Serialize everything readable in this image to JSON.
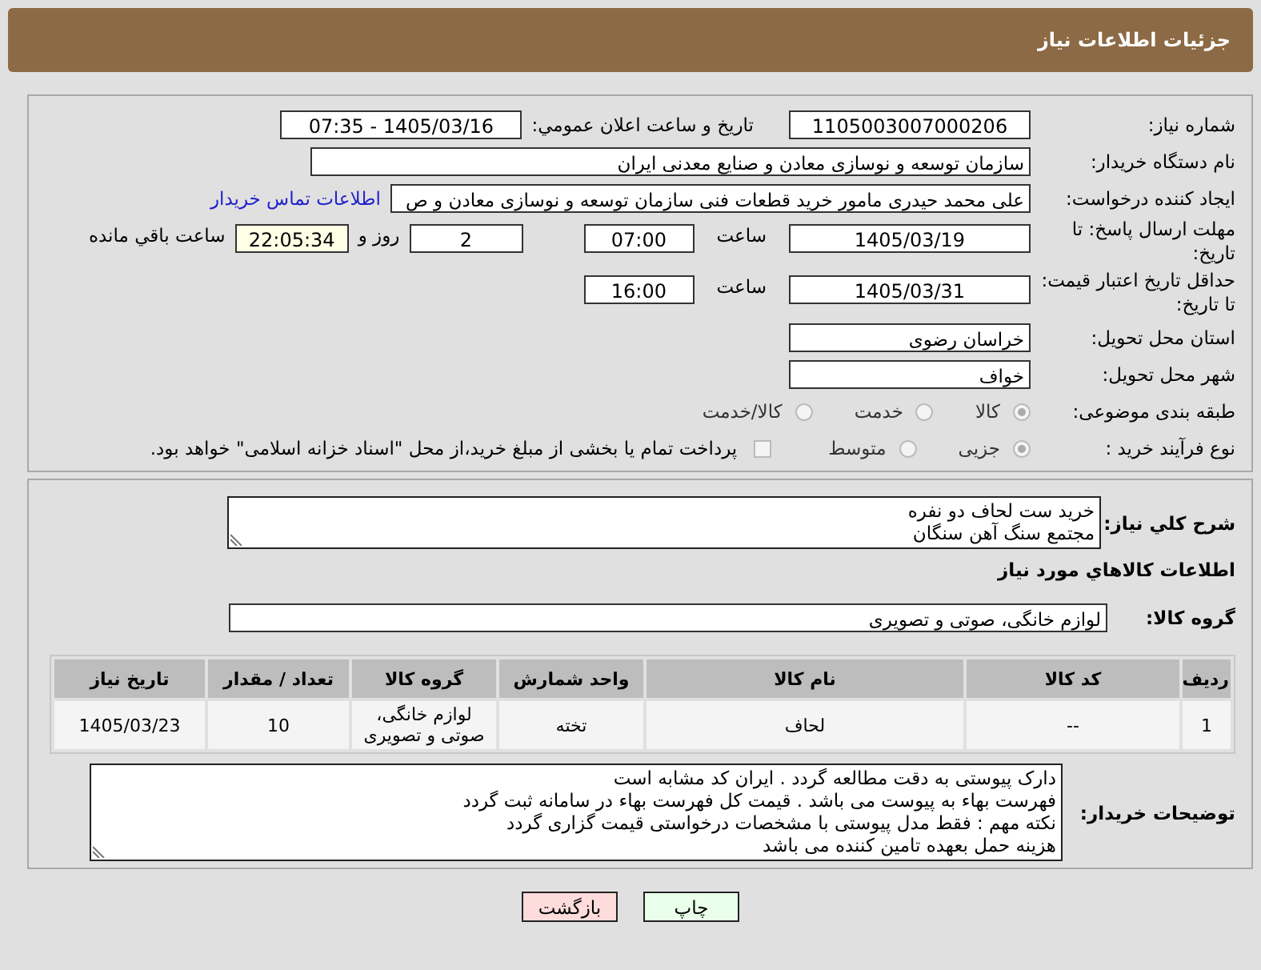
{
  "header": {
    "title": "جزئیات اطلاعات نیاز"
  },
  "need_number": {
    "label": "شماره نیاز:",
    "value": "1105003007000206"
  },
  "announce": {
    "label": "تاریخ و ساعت اعلان عمومي:",
    "value": "1405/03/16 - 07:35"
  },
  "buyer_org": {
    "label": "نام دستگاه خریدار:",
    "value": "سازمان توسعه و نوسازی معادن و صنایع معدنی ایران"
  },
  "requester": {
    "label": "ایجاد کننده درخواست:",
    "value": "علی محمد حیدری مامور خرید قطعات فنی سازمان توسعه و نوسازی معادن و ص",
    "link": "اطلاعات تماس خریدار"
  },
  "deadline": {
    "label": "مهلت ارسال پاسخ: تا تاریخ:",
    "date": "1405/03/19",
    "time_label": "ساعت",
    "time": "07:00",
    "days": "2",
    "days_label": "روز و",
    "remaining": "22:05:34",
    "remaining_label": "ساعت باقي مانده"
  },
  "validity": {
    "label": "حداقل تاریخ اعتبار قیمت: تا تاریخ:",
    "date": "1405/03/31",
    "time_label": "ساعت",
    "time": "16:00"
  },
  "province": {
    "label": "استان محل تحویل:",
    "value": "خراسان رضوی"
  },
  "city": {
    "label": "شهر محل تحویل:",
    "value": "خواف"
  },
  "category": {
    "label": "طبقه بندی موضوعی:",
    "options": [
      {
        "label": "کالا",
        "selected": true
      },
      {
        "label": "خدمت",
        "selected": false
      },
      {
        "label": "کالا/خدمت",
        "selected": false
      }
    ]
  },
  "process": {
    "label": "نوع فرآیند خرید :",
    "options": [
      {
        "label": "جزیی",
        "selected": true
      },
      {
        "label": "متوسط",
        "selected": false
      }
    ],
    "treasury": {
      "label": "پرداخت تمام یا بخشی از مبلغ خرید،از محل \"اسناد خزانه اسلامی\" خواهد بود.",
      "checked": false
    }
  },
  "description": {
    "label": "شرح کلي نیاز:",
    "lines": [
      "خرید ست لحاف دو نفره",
      "مجتمع سنگ آهن سنگان"
    ]
  },
  "goods_title": "اطلاعات کالاهاي مورد نیاز",
  "goods_group": {
    "label": "گروه کالا:",
    "value": "لوازم خانگی، صوتی و تصویری"
  },
  "table": {
    "columns": [
      "ردیف",
      "کد کالا",
      "نام کالا",
      "واحد شمارش",
      "گروه کالا",
      "تعداد / مقدار",
      "تاریخ نیاز"
    ],
    "rows": [
      [
        "1",
        "--",
        "لحاف",
        "تخته",
        "لوازم خانگی، صوتی و تصویری",
        "10",
        "1405/03/23"
      ]
    ]
  },
  "notes": {
    "label": "توضیحات خریدار:",
    "lines": [
      "دارک پیوستی به دقت مطالعه گردد . ایران کد مشابه است",
      "فهرست بهاء به پیوست می باشد . قیمت کل فهرست بهاء در سامانه ثبت گردد",
      "نکته مهم : فقط مدل پیوستی با مشخصات درخواستی قیمت گزاری گردد",
      "هزینه حمل بعهده تامین کننده می باشد"
    ]
  },
  "buttons": [
    {
      "label": "چاپ",
      "kind": "print"
    },
    {
      "label": "بازگشت",
      "kind": "back"
    }
  ]
}
